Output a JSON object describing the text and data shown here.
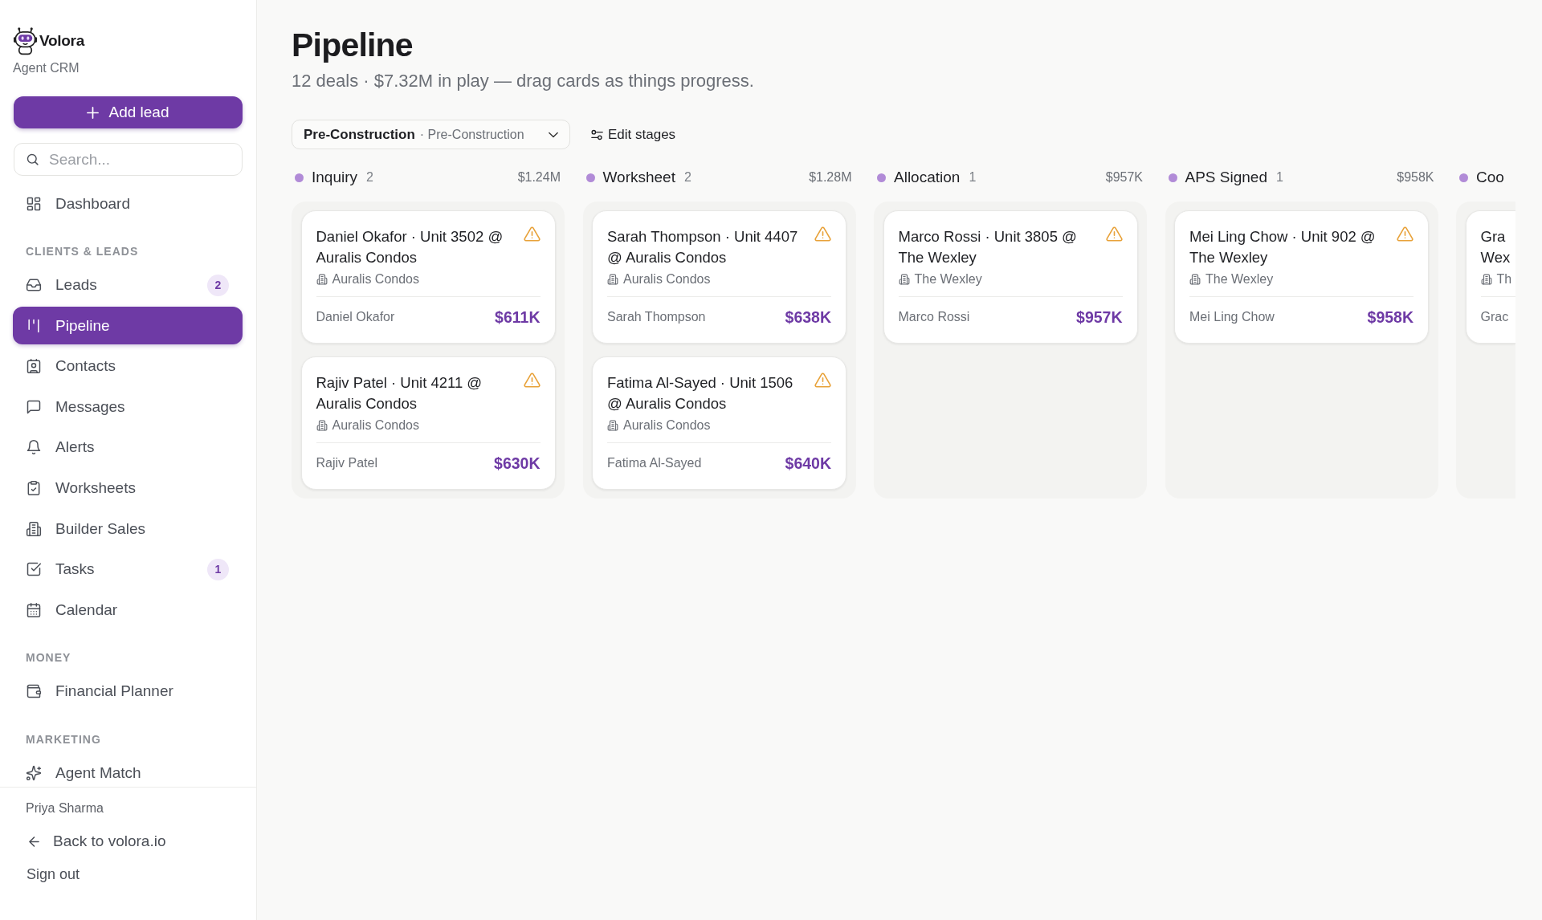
{
  "sidebar": {
    "brand": "Volora",
    "product": "Agent CRM",
    "add_button": "Add lead",
    "search": {
      "placeholder": "Search..."
    },
    "nav": [
      {
        "kind": "link",
        "label": "Dashboard",
        "selected": false
      },
      {
        "kind": "section",
        "label": "CLIENTS & LEADS"
      },
      {
        "kind": "link",
        "label": "Leads",
        "badge": "2",
        "selected": false
      },
      {
        "kind": "link",
        "label": "Pipeline",
        "selected": true
      },
      {
        "kind": "link",
        "label": "Contacts",
        "selected": false
      },
      {
        "kind": "link",
        "label": "Messages",
        "selected": false
      },
      {
        "kind": "link",
        "label": "Alerts",
        "selected": false
      },
      {
        "kind": "link",
        "label": "Worksheets",
        "selected": false
      },
      {
        "kind": "link",
        "label": "Builder Sales",
        "selected": false
      },
      {
        "kind": "link",
        "label": "Tasks",
        "badge": "1",
        "selected": false
      },
      {
        "kind": "link",
        "label": "Calendar",
        "selected": false
      },
      {
        "kind": "section",
        "label": "MONEY"
      },
      {
        "kind": "link",
        "label": "Financial Planner",
        "selected": false
      },
      {
        "kind": "section",
        "label": "MARKETING"
      },
      {
        "kind": "link",
        "label": "Agent Match",
        "selected": false
      }
    ],
    "footer": {
      "user": "Priya Sharma",
      "back_link": "Back to volora.io",
      "sign_out": "Sign out"
    }
  },
  "main": {
    "title": "Pipeline",
    "subtitle": "12 deals · $7.32M in play — drag cards as things progress.",
    "pipeline_select": {
      "label": "Pre-Construction",
      "detail": "· Pre-Construction"
    },
    "edit_button": "Edit stages",
    "board": {
      "columns": [
        {
          "name": "Inquiry",
          "count": "2",
          "total": "$1.24M",
          "cards": [
            {
              "title": "Daniel Okafor · Unit 3502 @ Auralis Condos",
              "building": "Auralis Condos",
              "client": "Daniel Okafor",
              "amount": "$611K",
              "warning": true
            },
            {
              "title": "Rajiv Patel · Unit 4211 @ Auralis Condos",
              "building": "Auralis Condos",
              "client": "Rajiv Patel",
              "amount": "$630K",
              "warning": true
            }
          ]
        },
        {
          "name": "Worksheet",
          "count": "2",
          "total": "$1.28M",
          "cards": [
            {
              "title": "Sarah Thompson · Unit 4407 @ Auralis Condos",
              "building": "Auralis Condos",
              "client": "Sarah Thompson",
              "amount": "$638K",
              "warning": true
            },
            {
              "title": "Fatima Al-Sayed · Unit 1506 @ Auralis Condos",
              "building": "Auralis Condos",
              "client": "Fatima Al-Sayed",
              "amount": "$640K",
              "warning": true
            }
          ]
        },
        {
          "name": "Allocation",
          "count": "1",
          "total": "$957K",
          "cards": [
            {
              "title": "Marco Rossi · Unit 3805 @ The Wexley",
              "building": "The Wexley",
              "client": "Marco Rossi",
              "amount": "$957K",
              "warning": true
            }
          ]
        },
        {
          "name": "APS Signed",
          "count": "1",
          "total": "$958K",
          "cards": [
            {
              "title": "Mei Ling Chow · Unit 902 @ The Wexley",
              "building": "The Wexley",
              "client": "Mei Ling Chow",
              "amount": "$958K",
              "warning": true
            }
          ]
        },
        {
          "name": "Coo",
          "cards": [
            {
              "title": "Gra Wex",
              "building": "Th",
              "client": "Grac"
            }
          ]
        }
      ]
    }
  }
}
